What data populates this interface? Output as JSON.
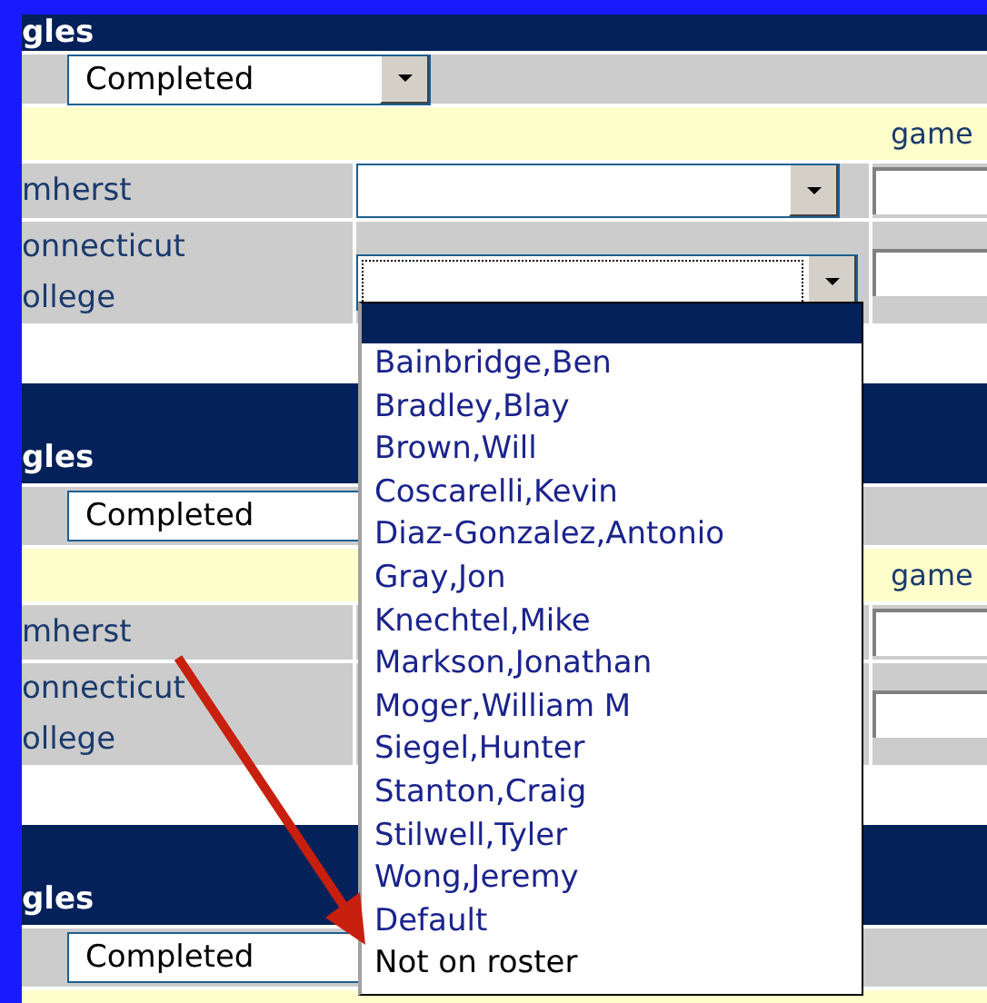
{
  "sections": [
    {
      "title": "gles",
      "status": "Completed",
      "column_header": "game",
      "rows": [
        {
          "label_lines": [
            "mherst"
          ],
          "focused": false
        },
        {
          "label_lines": [
            "onnecticut",
            "ollege"
          ],
          "focused": true
        }
      ]
    },
    {
      "title": "gles",
      "status": "Completed",
      "column_header": "game",
      "rows": [
        {
          "label_lines": [
            "mherst"
          ]
        },
        {
          "label_lines": [
            "onnecticut",
            "ollege"
          ]
        }
      ]
    },
    {
      "title": "gles",
      "status": "Completed"
    }
  ],
  "open_dropdown": {
    "blank_option_selected": true,
    "options": [
      {
        "label": "Bainbridge,Ben",
        "kind": "player"
      },
      {
        "label": "Bradley,Blay",
        "kind": "player"
      },
      {
        "label": "Brown,Will",
        "kind": "player"
      },
      {
        "label": "Coscarelli,Kevin",
        "kind": "player"
      },
      {
        "label": "Diaz-Gonzalez,Antonio",
        "kind": "player"
      },
      {
        "label": "Gray,Jon",
        "kind": "player"
      },
      {
        "label": "Knechtel,Mike",
        "kind": "player"
      },
      {
        "label": "Markson,Jonathan",
        "kind": "player"
      },
      {
        "label": "Moger,William M",
        "kind": "player"
      },
      {
        "label": "Siegel,Hunter",
        "kind": "player"
      },
      {
        "label": "Stanton,Craig",
        "kind": "player"
      },
      {
        "label": "Stilwell,Tyler",
        "kind": "player"
      },
      {
        "label": "Wong,Jeremy",
        "kind": "player"
      },
      {
        "label": "Default",
        "kind": "player"
      },
      {
        "label": "Not on roster",
        "kind": "other"
      }
    ]
  }
}
